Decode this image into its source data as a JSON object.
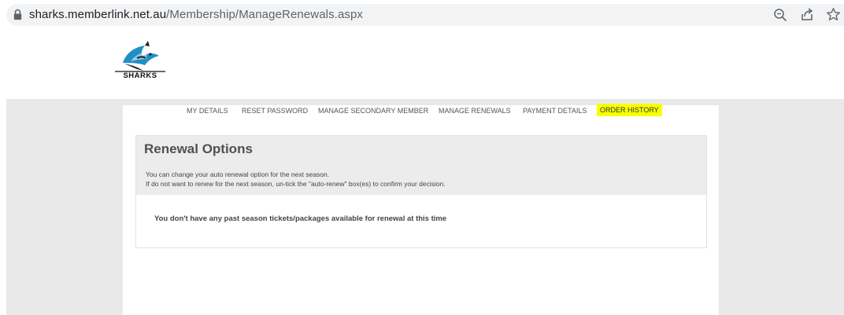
{
  "browser": {
    "url_host": "sharks.memberlink.net.au",
    "url_path": "/Membership/ManageRenewals.aspx",
    "icons": [
      "lock-icon",
      "zoom-icon",
      "share-icon",
      "star-icon"
    ]
  },
  "site": {
    "logo_text": "SHARKS",
    "colors": {
      "band": "#e9e9e9",
      "highlight": "#f7ff00",
      "shark_blue": "#1e8fc8"
    }
  },
  "nav": {
    "my_details": "MY DETAILS",
    "reset_password": "RESET PASSWORD",
    "manage_secondary_member": "MANAGE SECONDARY MEMBER",
    "manage_renewals": "MANAGE RENEWALS",
    "payment_details": "PAYMENT DETAILS",
    "order_history": "ORDER HISTORY"
  },
  "renewal": {
    "title": "Renewal Options",
    "desc_line1": "You can change your auto renewal option for the next season.",
    "desc_line2": "If do not want to renew for the next season, un-tick the \"auto-renew\" box(es) to confirm your decision.",
    "message": "You don't have any past season tickets/packages available for renewal at this time"
  }
}
